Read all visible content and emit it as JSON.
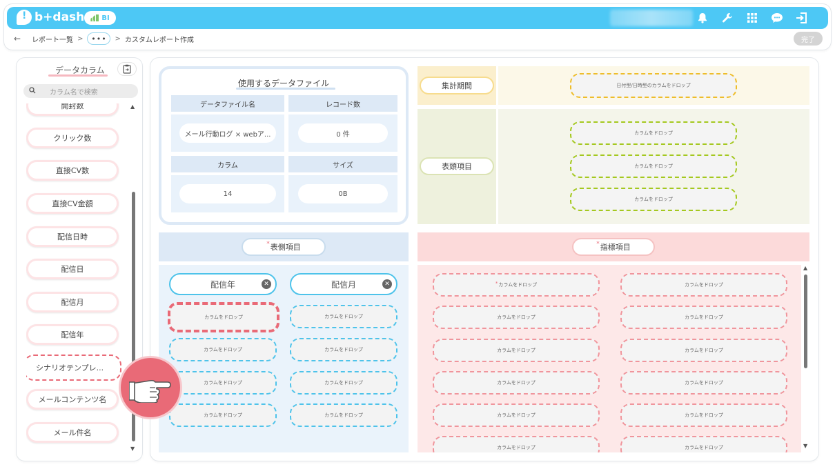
{
  "app": {
    "logo_text": "b+dash",
    "bi_badge": "BI"
  },
  "breadcrumb": {
    "back": "←",
    "items": [
      "レポート一覧",
      "カスタムレポート作成"
    ],
    "separator": ">",
    "ellipsis": "•••"
  },
  "toolbar": {
    "done_label": "完了"
  },
  "sidebar": {
    "title": "データカラム",
    "search_placeholder": "カラム名で検索",
    "columns": [
      "開封数",
      "クリック数",
      "直接CV数",
      "直接CV金額",
      "配信日時",
      "配信日",
      "配信月",
      "配信年",
      "シナリオテンプレ...",
      "メールコンテンツ名",
      "メール件名"
    ]
  },
  "datafile": {
    "title": "使用するデータファイル",
    "headers": [
      "データファイル名",
      "レコード数",
      "カラム",
      "サイズ"
    ],
    "values": [
      "メール行動ログ × webア...",
      "0 件",
      "14",
      "0B"
    ]
  },
  "period": {
    "label": "集計期間",
    "drop_placeholder": "日付型/日時型のカラムをドロップ"
  },
  "header_items": {
    "label": "表頭項目",
    "drop_placeholder": "カラムをドロップ",
    "slots": 3
  },
  "side_items": {
    "label": "表側項目",
    "required_mark": "*",
    "chips": [
      "配信年",
      "配信月"
    ],
    "chip_close": "✕",
    "drop_placeholder": "カラムをドロップ"
  },
  "indicator_items": {
    "label": "指標項目",
    "required_mark": "*",
    "drop_placeholder": "カラムをドロップ",
    "first_drop_required_mark": "*"
  },
  "icons": {
    "bell": "bell-icon",
    "wrench": "wrench-icon",
    "grid": "grid-icon",
    "chat": "chat-icon",
    "logout": "logout-icon",
    "search": "search-icon",
    "copy": "clipboard-icon",
    "hand": "pointing-hand-icon"
  },
  "colors": {
    "accent": "#4dc8f5",
    "danger": "#e96a77",
    "yellow": "#eebd2a",
    "green": "#a4c81e"
  }
}
